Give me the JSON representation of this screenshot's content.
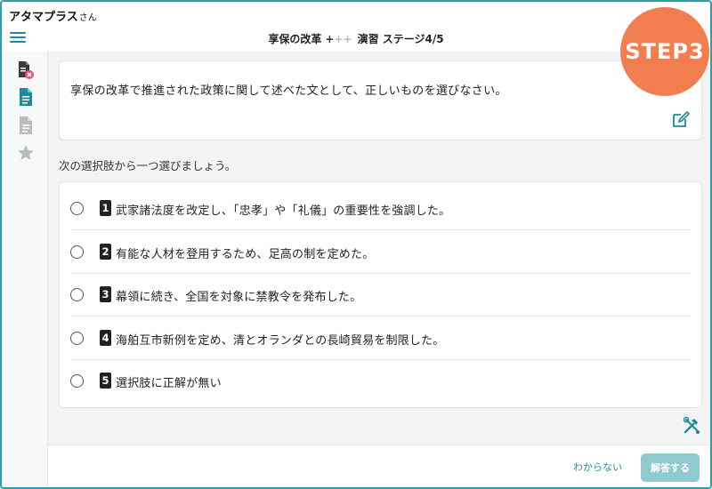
{
  "user": {
    "name": "アタマプラス",
    "honorific": "さん"
  },
  "header": {
    "title": "享保の改革",
    "plus_main": "+",
    "plus_faint": "++",
    "practice_label": "演習 ステージ4/5"
  },
  "step_badge": "STEP3",
  "sidebar": {
    "items": [
      {
        "icon": "document-error-icon"
      },
      {
        "icon": "document-icon"
      },
      {
        "icon": "document-gray-icon"
      },
      {
        "icon": "star-icon"
      }
    ]
  },
  "question": {
    "text": "享保の改革で推進された政策に関して述べた文として、正しいものを選びなさい。"
  },
  "instruction": "次の選択肢から一つ選びましょう。",
  "choices": [
    {
      "number": "1",
      "text": "武家諸法度を改定し、「忠孝」や「礼儀」の重要性を強調した。"
    },
    {
      "number": "2",
      "text": "有能な人材を登用するため、足高の制を定めた。"
    },
    {
      "number": "3",
      "text": "幕領に続き、全国を対象に禁教令を発布した。"
    },
    {
      "number": "4",
      "text": "海舶互市新例を定め、清とオランダとの長崎貿易を制限した。"
    },
    {
      "number": "5",
      "text": "選択肢に正解が無い"
    }
  ],
  "footer": {
    "dont_know_label": "わからない",
    "answer_label": "解答する"
  },
  "colors": {
    "accent": "#2aa0a8",
    "step_badge": "#f27e4f",
    "answer_button": "#8fcad0"
  }
}
